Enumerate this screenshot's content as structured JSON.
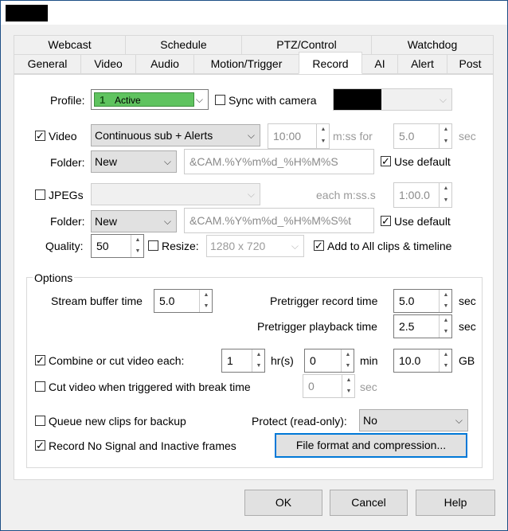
{
  "tabs_top": [
    "Webcast",
    "Schedule",
    "PTZ/Control",
    "Watchdog"
  ],
  "tabs_bottom": [
    "General",
    "Video",
    "Audio",
    "Motion/Trigger",
    "Record",
    "AI",
    "Alert",
    "Post"
  ],
  "active_tab": "Record",
  "profile": {
    "label": "Profile:",
    "number": "1",
    "value": "Active",
    "sync_label": "Sync with camera",
    "sync_checked": false
  },
  "video": {
    "checkbox_label": "Video",
    "checked": true,
    "mode": "Continuous sub + Alerts",
    "time": "10:00",
    "time_label": "m:ss for",
    "for_value": "5.0",
    "for_unit": "sec"
  },
  "video_folder": {
    "label": "Folder:",
    "value": "New",
    "pattern": "&CAM.%Y%m%d_%H%M%S",
    "default_label": "Use default",
    "default_checked": true
  },
  "jpegs": {
    "checkbox_label": "JPEGs",
    "checked": false,
    "each_label": "each m:ss.s",
    "each_value": "1:00.0"
  },
  "jpeg_folder": {
    "label": "Folder:",
    "value": "New",
    "pattern": "&CAM.%Y%m%d_%H%M%S%t",
    "default_label": "Use default",
    "default_checked": true
  },
  "quality": {
    "label": "Quality:",
    "value": "50",
    "resize_label": "Resize:",
    "resize_checked": false,
    "resize_value": "1280 x 720",
    "add_label": "Add  to All clips & timeline",
    "add_checked": true
  },
  "options": {
    "group_label": "Options",
    "stream_buffer_label": "Stream buffer time",
    "stream_buffer_value": "5.0",
    "pretrigger_record_label": "Pretrigger record time",
    "pretrigger_record_value": "5.0",
    "pretrigger_record_unit": "sec",
    "pretrigger_playback_label": "Pretrigger playback time",
    "pretrigger_playback_value": "2.5",
    "pretrigger_playback_unit": "sec",
    "combine_label": "Combine or cut video each:",
    "combine_checked": true,
    "combine_hr": "1",
    "combine_hr_unit": "hr(s)",
    "combine_min": "0",
    "combine_min_unit": "min",
    "combine_gb": "10.0",
    "combine_gb_unit": "GB",
    "cut_label": "Cut video when triggered with break time",
    "cut_checked": false,
    "cut_value": "0",
    "cut_unit": "sec",
    "queue_label": "Queue new clips for backup",
    "queue_checked": false,
    "protect_label": "Protect (read-only):",
    "protect_value": "No",
    "record_nosignal_label": "Record No Signal and Inactive frames",
    "record_nosignal_checked": true,
    "file_format_button": "File format and compression..."
  },
  "buttons": {
    "ok": "OK",
    "cancel": "Cancel",
    "help": "Help"
  },
  "colors": {
    "accent_border": "#0078d7",
    "profile_active": "#5fc35f",
    "window_border": "#1d4f86"
  },
  "icons": {
    "up": "▲",
    "down": "▼",
    "dropdown": "⌵"
  }
}
